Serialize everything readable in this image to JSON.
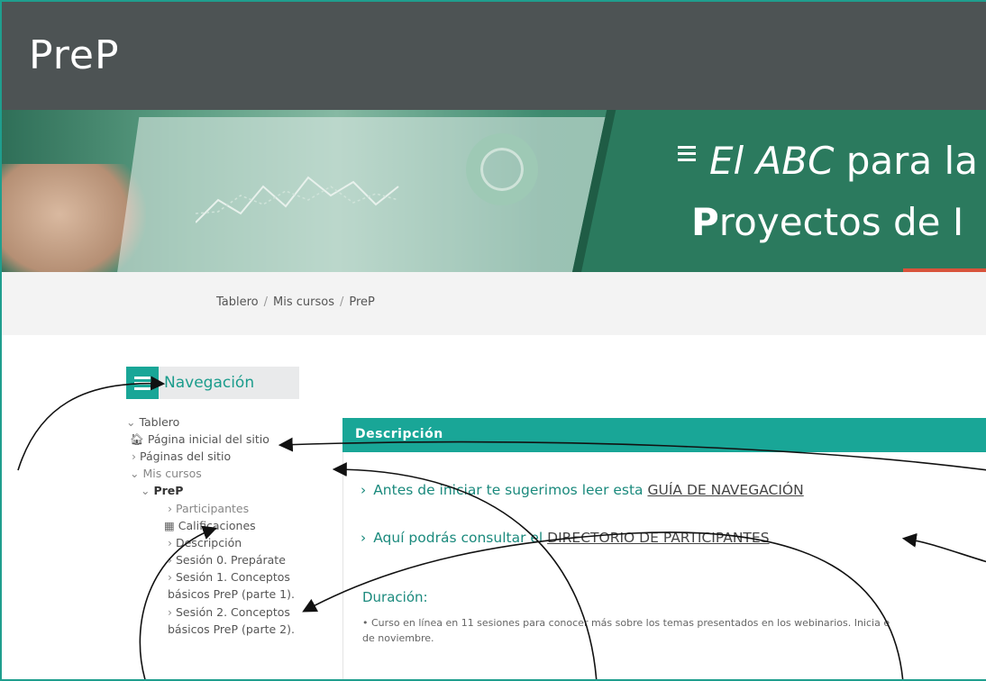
{
  "header": {
    "brand": "PreP"
  },
  "banner": {
    "line1_em": "El ABC",
    "line1_rest": " para la",
    "line2_bold": "P",
    "line2_rest": "royectos de I",
    "accent_color": "#1b8a7d"
  },
  "breadcrumb": {
    "items": [
      "Tablero",
      "Mis cursos",
      "PreP"
    ],
    "separator": "/"
  },
  "navigation": {
    "title": "Navegación",
    "tree": {
      "tablero": "Tablero",
      "home": "Página inicial del sitio",
      "site_pages": "Páginas del sitio",
      "my_courses": "Mis cursos",
      "course": "PreP",
      "participants": "Participantes",
      "grades": "Calificaciones",
      "description": "Descripción",
      "session0": "Sesión 0. Prepárate",
      "session1_a": "Sesión 1. Conceptos",
      "session1_b": "básicos PreP (parte 1).",
      "session2_a": "Sesión 2. Conceptos",
      "session2_b": "básicos PreP (parte 2)."
    }
  },
  "description": {
    "header": "Descripción",
    "item1_prefix": "Antes de iniciar te sugerimos leer esta ",
    "item1_link": "GUÍA DE NAVEGACIÓN",
    "item2_prefix": "Aquí podrás consultar el ",
    "item2_link": "DIRECTORIO DE PARTICIPANTES",
    "duration_title": "Duración:",
    "duration_text": "Curso en línea en 11 sesiones para conocer más sobre los temas presentados en los webinarios. Inicia e",
    "duration_text_2": "de noviembre."
  },
  "icons": {
    "menu": "hamburger-icon",
    "home": "home-icon",
    "grades": "table-icon"
  }
}
